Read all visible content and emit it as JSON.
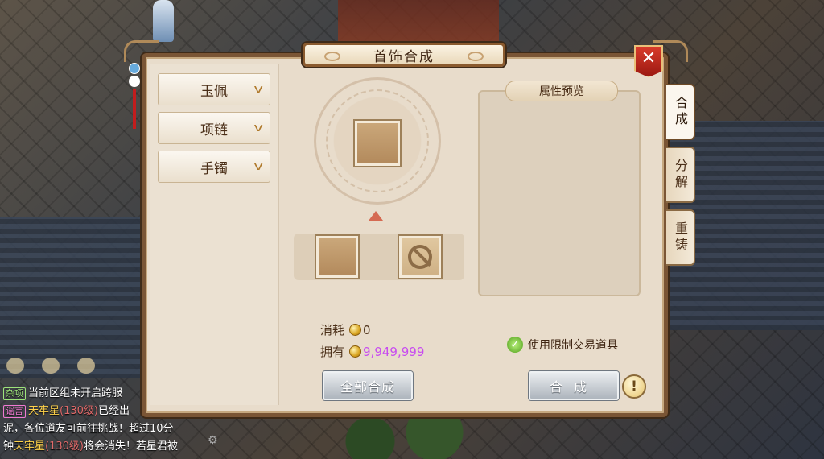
{
  "dialog": {
    "title": "首饰合成",
    "close_icon": "close-icon"
  },
  "left_menu": {
    "items": [
      {
        "label": "玉佩"
      },
      {
        "label": "项链"
      },
      {
        "label": "手镯"
      }
    ]
  },
  "side_tabs": [
    {
      "label": "合成",
      "active": true
    },
    {
      "label": "分解",
      "active": false
    },
    {
      "label": "重铸",
      "active": false
    }
  ],
  "preview": {
    "title": "属性预览"
  },
  "cost": {
    "consume_label": "消耗",
    "consume_value": "0",
    "owned_label": "拥有",
    "owned_value": "9,949,999"
  },
  "options": {
    "use_restricted_label": "使用限制交易道具",
    "use_restricted_checked": true
  },
  "buttons": {
    "compose_all": "全部合成",
    "compose": "合成",
    "info": "!"
  },
  "chat": {
    "lines": [
      {
        "tag": "杂项",
        "text": "当前区组未开启跨服"
      },
      {
        "tag": "谣言",
        "name": "天牢星",
        "level": "(130级)",
        "text": "已经出"
      },
      {
        "text": "泥，各位道友可前往挑战！超过10分"
      },
      {
        "prefix": "钟",
        "name": "天牢星",
        "level": "(130级)",
        "text": "将会消失！若星君被"
      }
    ]
  },
  "colors": {
    "panel_bg": "#e8dccb",
    "frame": "#7a5535",
    "owned_value": "#c84cf0",
    "close_red": "#c62a1e"
  }
}
